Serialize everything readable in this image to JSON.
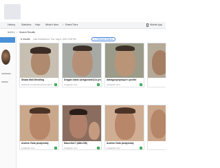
{
  "nav": {
    "items": [
      "History",
      "Statistics",
      "Help",
      "What's New"
    ],
    "star_label": "☆ ",
    "rated_label": "Rated Tiers",
    "mobile_label": "Mobile App"
  },
  "breadcrumb": {
    "id": "/#.10.1",
    "arrow": "›",
    "label": "Search Results"
  },
  "toolbar": {
    "results": "6 results",
    "last_check": "Last Checked on: Thu, Aug 4, 2022 2:08 PM",
    "recheck": "↻ Recheck Search"
  },
  "cards": [
    {
      "title": "Shada Mail Wedding",
      "domain": "facebook.com/photos/photo.php?...",
      "verified": "✓"
    },
    {
      "title": "Dragan Ivanić (dragonivan1)'s profile",
      "domain": "instagram.com",
      "verified": "✓"
    },
    {
      "title": "didragonphysique's profile",
      "domain": "instagram.com",
      "verified": "✓"
    },
    {
      "title": "Andrea Viola (andyviola)",
      "domain": "instagram.com",
      "verified": "✓"
    },
    {
      "title": "Marcello17 (ШМ-238)",
      "domain": "instagram.com",
      "verified": "✓"
    },
    {
      "title": "Andrea Viola (andyviola)",
      "domain": "instagram.com",
      "verified": "✓"
    }
  ],
  "colors": {
    "accent": "#3b7ddd",
    "verified": "#2ea44f"
  }
}
